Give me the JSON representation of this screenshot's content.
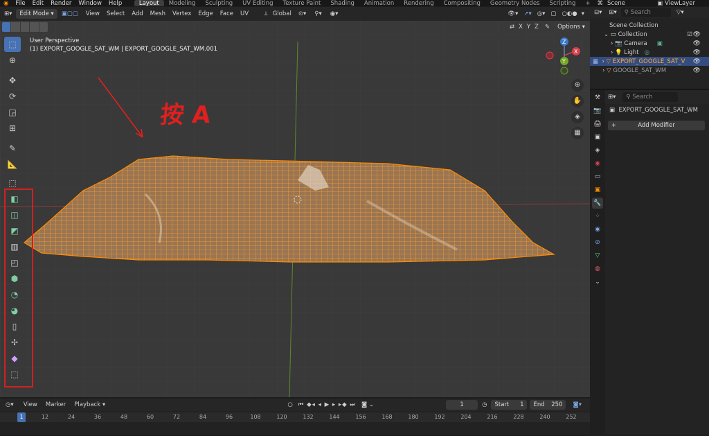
{
  "menus": [
    "File",
    "Edit",
    "Render",
    "Window",
    "Help"
  ],
  "workspaces": [
    {
      "label": "Layout",
      "active": true
    },
    {
      "label": "Modeling"
    },
    {
      "label": "Sculpting"
    },
    {
      "label": "UV Editing"
    },
    {
      "label": "Texture Paint"
    },
    {
      "label": "Shading"
    },
    {
      "label": "Animation"
    },
    {
      "label": "Rendering"
    },
    {
      "label": "Compositing"
    },
    {
      "label": "Geometry Nodes"
    },
    {
      "label": "Scripting"
    }
  ],
  "scene": "Scene",
  "view_layer": "ViewLayer",
  "header": {
    "mode": "Edit Mode",
    "menus": [
      "View",
      "Select",
      "Add",
      "Mesh",
      "Vertex",
      "Edge",
      "Face",
      "UV"
    ],
    "orientation": "Global",
    "options": "Options",
    "axes": [
      "X",
      "Y",
      "Z"
    ]
  },
  "viewport": {
    "view_name": "User Perspective",
    "object_info": "(1) EXPORT_GOOGLE_SAT_WM | EXPORT_GOOGLE_SAT_WM.001",
    "annotation": "按 A"
  },
  "outliner": {
    "search_placeholder": "Search",
    "root": "Scene Collection",
    "collection": "Collection",
    "items": [
      "Camera",
      "Light",
      "EXPORT_GOOGLE_SAT_V",
      "GOOGLE_SAT_WM"
    ]
  },
  "properties": {
    "search_placeholder": "Search",
    "object_name": "EXPORT_GOOGLE_SAT_WM",
    "add_modifier": "Add Modifier"
  },
  "timeline": {
    "menus": [
      "View",
      "Marker",
      "Playback"
    ],
    "current_frame": "1",
    "start_label": "Start",
    "start": "1",
    "end_label": "End",
    "end": "250",
    "ticks": [
      "1",
      "12",
      "24",
      "36",
      "48",
      "60",
      "72",
      "84",
      "96",
      "108",
      "120",
      "132",
      "144",
      "156",
      "168",
      "180",
      "192",
      "204",
      "216",
      "228",
      "240",
      "252"
    ]
  },
  "colors": {
    "accent": "#4772b3",
    "selection": "#ff8a00",
    "annotation": "#e02020"
  }
}
